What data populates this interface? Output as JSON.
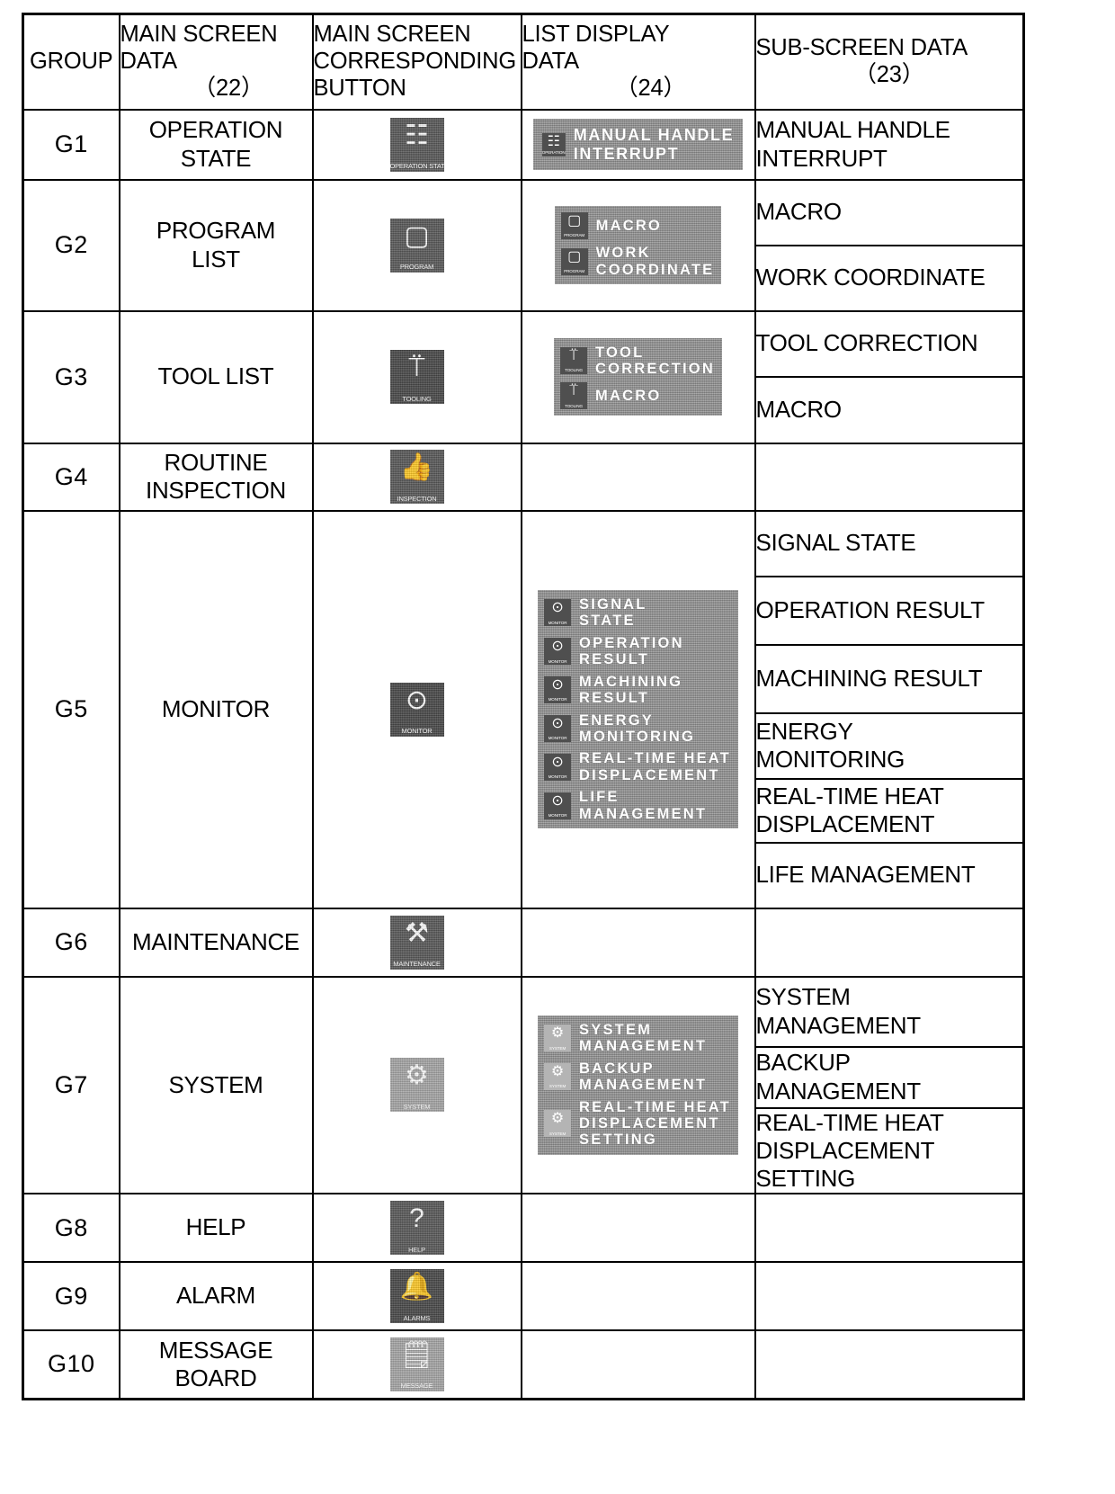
{
  "table": {
    "headers": [
      {
        "label": "GROUP",
        "number": ""
      },
      {
        "label": "MAIN SCREEN\nDATA",
        "number": "（22）"
      },
      {
        "label": "MAIN SCREEN\nCORRESPONDING\nBUTTON",
        "number": ""
      },
      {
        "label": "LIST DISPLAY\nDATA",
        "number": "（24）"
      },
      {
        "label": "SUB-SCREEN DATA",
        "number": "（23）"
      }
    ],
    "rows": [
      {
        "group": "G1",
        "main_screen_data": "OPERATION\nSTATE",
        "button": {
          "caption": "OPERATION\nSTATE",
          "icon": "operation-state-icon",
          "glyph": "☷",
          "shade": "dark"
        },
        "list_items": [
          {
            "label": "MANUAL HANDLE\nINTERRUPT",
            "icon": "operation-state-icon",
            "caption": "OPERATION\nSTATE",
            "glyph": "☷"
          }
        ],
        "list_layout": "oneline",
        "sub_screen_data": [
          "MANUAL HANDLE\nINTERRUPT"
        ]
      },
      {
        "group": "G2",
        "main_screen_data": "PROGRAM\nLIST",
        "button": {
          "caption": "PROGRAM",
          "icon": "program-icon",
          "glyph": "▢",
          "shade": "dark"
        },
        "list_items": [
          {
            "label": "MACRO",
            "icon": "program-icon",
            "caption": "PROGRAM",
            "glyph": "▢"
          },
          {
            "label": "WORK\nCOORDINATE",
            "icon": "program-icon",
            "caption": "PROGRAM",
            "glyph": "▢"
          }
        ],
        "list_layout": "normal",
        "sub_screen_data": [
          "MACRO",
          "WORK COORDINATE"
        ]
      },
      {
        "group": "G3",
        "main_screen_data": "TOOL LIST",
        "button": {
          "caption": "TOOLING",
          "icon": "tooling-icon",
          "glyph": "⍡",
          "shade": "darker"
        },
        "list_items": [
          {
            "label": "TOOL\nCORRECTION",
            "icon": "tooling-icon",
            "caption": "TOOLING",
            "glyph": "⍡"
          },
          {
            "label": "MACRO",
            "icon": "tooling-icon",
            "caption": "TOOLING",
            "glyph": "⍡"
          }
        ],
        "list_layout": "normal",
        "sub_screen_data": [
          "TOOL CORRECTION",
          "MACRO"
        ]
      },
      {
        "group": "G4",
        "main_screen_data": "ROUTINE\nINSPECTION",
        "button": {
          "caption": "INSPECTION",
          "icon": "thumbs-up-icon",
          "glyph": "👍",
          "shade": "dark"
        },
        "list_items": [],
        "list_layout": "none",
        "sub_screen_data": []
      },
      {
        "group": "G5",
        "main_screen_data": "MONITOR",
        "button": {
          "caption": "MONITOR",
          "icon": "monitor-icon",
          "glyph": "⊙",
          "shade": "darker"
        },
        "list_items": [
          {
            "label": "SIGNAL\nSTATE",
            "icon": "monitor-icon",
            "caption": "MONITOR",
            "glyph": "⊙"
          },
          {
            "label": "OPERATION\nRESULT",
            "icon": "monitor-icon",
            "caption": "MONITOR",
            "glyph": "⊙"
          },
          {
            "label": "MACHINING\nRESULT",
            "icon": "monitor-icon",
            "caption": "MONITOR",
            "glyph": "⊙"
          },
          {
            "label": "ENERGY\nMONITORING",
            "icon": "monitor-icon",
            "caption": "MONITOR",
            "glyph": "⊙"
          },
          {
            "label": "REAL-TIME HEAT\nDISPLACEMENT",
            "icon": "monitor-icon",
            "caption": "MONITOR",
            "glyph": "⊙"
          },
          {
            "label": "LIFE\nMANAGEMENT",
            "icon": "monitor-icon",
            "caption": "MONITOR",
            "glyph": "⊙"
          }
        ],
        "list_layout": "normal",
        "sub_screen_data": [
          "SIGNAL STATE",
          "OPERATION RESULT",
          "MACHINING RESULT",
          "ENERGY\nMONITORING",
          "REAL-TIME HEAT\nDISPLACEMENT",
          "LIFE MANAGEMENT"
        ]
      },
      {
        "group": "G6",
        "main_screen_data": "MAINTENANCE",
        "button": {
          "caption": "MAINTENANCE",
          "icon": "tools-icon",
          "glyph": "⚒",
          "shade": "dark"
        },
        "list_items": [],
        "list_layout": "none",
        "sub_screen_data": []
      },
      {
        "group": "G7",
        "main_screen_data": "SYSTEM",
        "button": {
          "caption": "SYSTEM",
          "icon": "gears-icon",
          "glyph": "⚙",
          "shade": "light"
        },
        "list_items": [
          {
            "label": "SYSTEM\nMANAGEMENT",
            "icon": "gears-icon",
            "caption": "SYSTEM",
            "glyph": "⚙"
          },
          {
            "label": "BACKUP\nMANAGEMENT",
            "icon": "gears-icon",
            "caption": "SYSTEM",
            "glyph": "⚙"
          },
          {
            "label": "REAL-TIME HEAT\nDISPLACEMENT\nSETTING",
            "icon": "gears-icon",
            "caption": "SYSTEM",
            "glyph": "⚙"
          }
        ],
        "list_layout": "pale",
        "sub_screen_data": [
          "SYSTEM\nMANAGEMENT",
          "BACKUP\nMANAGEMENT",
          "REAL-TIME HEAT\nDISPLACEMENT\nSETTING"
        ]
      },
      {
        "group": "G8",
        "main_screen_data": "HELP",
        "button": {
          "caption": "HELP",
          "icon": "question-mark-icon",
          "glyph": "?",
          "shade": "dark"
        },
        "list_items": [],
        "list_layout": "none",
        "sub_screen_data": []
      },
      {
        "group": "G9",
        "main_screen_data": "ALARM",
        "button": {
          "caption": "ALARMS",
          "icon": "bell-icon",
          "glyph": "🔔",
          "shade": "darker"
        },
        "list_items": [],
        "list_layout": "none",
        "sub_screen_data": []
      },
      {
        "group": "G10",
        "main_screen_data": "MESSAGE\nBOARD",
        "button": {
          "caption": "MESSAGE",
          "icon": "message-board-icon",
          "glyph": "🗒",
          "shade": "light"
        },
        "list_items": [],
        "list_layout": "none",
        "sub_screen_data": []
      }
    ]
  }
}
